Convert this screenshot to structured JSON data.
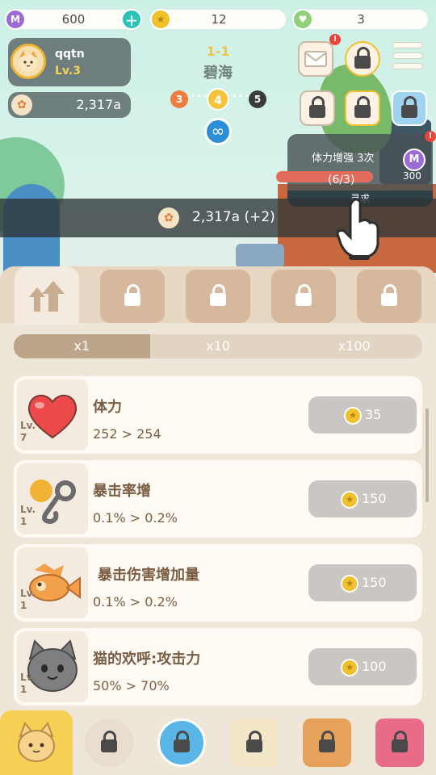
{
  "currency": {
    "gems": "600",
    "gem_icon_label": "M",
    "coins": "12",
    "hearts": "3"
  },
  "player": {
    "name": "qqtn",
    "level": "Lv.3"
  },
  "paw_total": "2,317a",
  "stage": {
    "id": "1-1",
    "name": "碧海",
    "prev": "3",
    "current": "4",
    "next": "5",
    "infinity": "∞"
  },
  "quest": {
    "title": "体力增强 3次",
    "progress": "(6/3)",
    "progress_ratio": 1.0,
    "reward": "300",
    "reward_icon_label": "M",
    "action": "寻求"
  },
  "income": "2,317a (+2)",
  "multiplier": {
    "options": [
      "x1",
      "x10",
      "x100"
    ],
    "selected": "x1"
  },
  "upgrades": [
    {
      "name": "体力",
      "level_prefix": "Lv.",
      "level": "7",
      "value": "252 > 254",
      "cost": "35",
      "icon": "heart-icon"
    },
    {
      "name": "暴击率增",
      "level_prefix": "Lv.",
      "level": "1",
      "value": "0.1% > 0.2%",
      "cost": "150",
      "icon": "hook-icon"
    },
    {
      "name": "暴击伤害增加量",
      "level_prefix": "Lv.",
      "level": "1",
      "value": "0.1% > 0.2%",
      "cost": "150",
      "icon": "fish-icon"
    },
    {
      "name": "猫的欢呼:攻击力",
      "level_prefix": "Lv.",
      "level": "1",
      "value": "50% > 70%",
      "cost": "100",
      "icon": "cat-face-icon"
    }
  ],
  "colors": {
    "accent_yellow": "#f7cf55",
    "panel_bg": "#efe6da",
    "button_disabled": "#c9c6c3",
    "brown_text": "#7a5e44"
  }
}
